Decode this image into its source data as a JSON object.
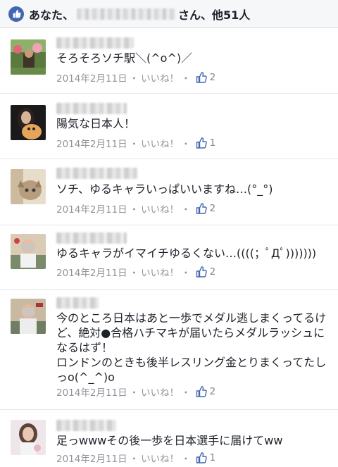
{
  "header": {
    "likes_prefix": "あなた、",
    "likes_suffix": "さん、他51人"
  },
  "comments": [
    {
      "text": "そろそろソチ駅＼(^o^)／",
      "date": "2014年2月11日",
      "like_label": "いいね！",
      "like_count": "2"
    },
    {
      "text": "陽気な日本人！",
      "date": "2014年2月11日",
      "like_label": "いいね！",
      "like_count": "1"
    },
    {
      "text": "ソチ、ゆるキャラいっぱいいますね…(°_°)",
      "date": "2014年2月11日",
      "like_label": "いいね！",
      "like_count": "2"
    },
    {
      "text": "ゆるキャラがイマイチゆるくない…((((；ﾟДﾟ)))))))",
      "date": "2014年2月11日",
      "like_label": "いいね！",
      "like_count": "2"
    },
    {
      "text": "今のところ日本はあと一歩でメダル逃しまくってるけど、絶対●合格ハチマキが届いたらメダルラッシュになるはず！\nロンドンのときも後半レスリング金とりまくってたしっo(^_^)o",
      "date": "2014年2月11日",
      "like_label": "いいね！",
      "like_count": "2"
    },
    {
      "text": "足っwwwその後一歩を日本選手に届けてww",
      "date": "2014年2月11日",
      "like_label": "いいね！",
      "like_count": "1"
    }
  ],
  "separator": "・",
  "colors": {
    "accent": "#4267b2",
    "meta": "#90949c",
    "divider": "#e4e6eb"
  }
}
